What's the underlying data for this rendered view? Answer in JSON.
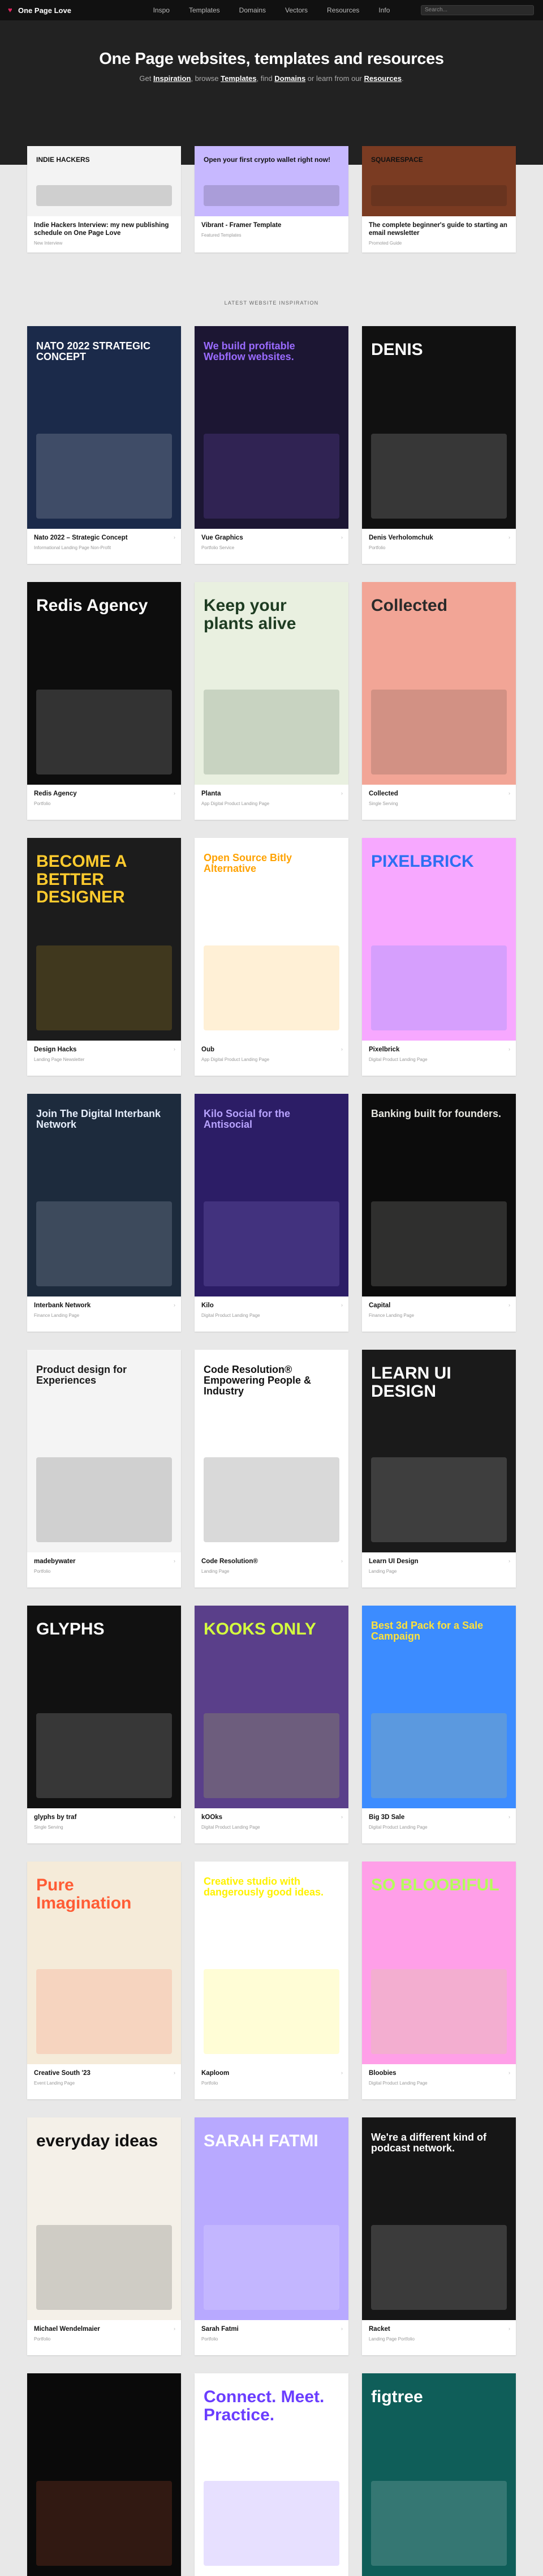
{
  "site": {
    "name": "One Page Love"
  },
  "nav": {
    "items": [
      "Inspo",
      "Templates",
      "Domains",
      "Vectors",
      "Resources",
      "Info"
    ]
  },
  "search": {
    "placeholder": "Search..."
  },
  "hero": {
    "title": "One Page websites, templates and resources",
    "sub_pre": "Get ",
    "inspiration": "Inspiration",
    "sub_mid1": ", browse ",
    "templates": "Templates",
    "sub_mid2": ", find ",
    "domains": "Domains",
    "sub_mid3": " or learn from our ",
    "resources": "Resources",
    "sub_end": "."
  },
  "featured": [
    {
      "title": "Indie Hackers Interview: my new publishing schedule on One Page Love",
      "tag": "New Interview",
      "thumb_text": "INDIE HACKERS",
      "bg": "#f3f3f3"
    },
    {
      "title": "Vibrant - Framer Template",
      "tag": "Featured Templates",
      "thumb_text": "Open your first crypto wallet right now!",
      "bg": "#c7b8ff"
    },
    {
      "title": "The complete beginner's guide to starting an email newsletter",
      "tag": "Promoted Guide",
      "thumb_text": "SQUARESPACE",
      "bg": "#7a3b22"
    }
  ],
  "section": {
    "label": "LATEST WEBSITE INSPIRATION"
  },
  "cards": [
    {
      "title": "Nato 2022 – Strategic Concept",
      "tags": [
        "Informational",
        "Landing Page",
        "Non-Profit"
      ],
      "bg": "#1b2a4a",
      "accent": "#ffffff",
      "thumb_text": "NATO 2022 STRATEGIC CONCEPT"
    },
    {
      "title": "Vue Graphics",
      "tags": [
        "Portfolio",
        "Service"
      ],
      "bg": "#1c1633",
      "accent": "#9a6bff",
      "thumb_text": "We build profitable Webflow websites."
    },
    {
      "title": "Denis Verholomchuk",
      "tags": [
        "Portfolio"
      ],
      "bg": "#111111",
      "accent": "#ffffff",
      "thumb_text": "DENIS"
    },
    {
      "title": "Redis Agency",
      "tags": [
        "Portfolio"
      ],
      "bg": "#0d0d0d",
      "accent": "#ffffff",
      "thumb_text": "Redis Agency"
    },
    {
      "title": "Planta",
      "tags": [
        "App",
        "Digital Product",
        "Landing Page"
      ],
      "bg": "#e9f0e0",
      "accent": "#1e3c22",
      "thumb_text": "Keep your plants alive"
    },
    {
      "title": "Collected",
      "tags": [
        "Single Serving"
      ],
      "bg": "#f2a596",
      "accent": "#2a2a2a",
      "thumb_text": "Collected"
    },
    {
      "title": "Design Hacks",
      "tags": [
        "Landing Page",
        "Newsletter"
      ],
      "bg": "#1c1c1c",
      "accent": "#ffcb2e",
      "thumb_text": "BECOME A BETTER DESIGNER"
    },
    {
      "title": "Oub",
      "tags": [
        "App",
        "Digital Product",
        "Landing Page"
      ],
      "bg": "#ffffff",
      "accent": "#ffa200",
      "thumb_text": "Open Source Bitly Alternative"
    },
    {
      "title": "Pixelbrick",
      "tags": [
        "Digital Product",
        "Landing Page"
      ],
      "bg": "#f7a8ff",
      "accent": "#2d6ff2",
      "thumb_text": "PIXELBRICK"
    },
    {
      "title": "Interbank Network",
      "tags": [
        "Finance",
        "Landing Page"
      ],
      "bg": "#1d2b3d",
      "accent": "#e6eefc",
      "thumb_text": "Join The Digital Interbank Network"
    },
    {
      "title": "Kilo",
      "tags": [
        "Digital Product",
        "Landing Page"
      ],
      "bg": "#2c1d66",
      "accent": "#b8a3ff",
      "thumb_text": "Kilo Social for the Antisocial"
    },
    {
      "title": "Capital",
      "tags": [
        "Finance",
        "Landing Page"
      ],
      "bg": "#0c0c0c",
      "accent": "#e8e8e2",
      "thumb_text": "Banking built for founders."
    },
    {
      "title": "madebywater",
      "tags": [
        "Portfolio"
      ],
      "bg": "#f4f4f4",
      "accent": "#1a1a1a",
      "thumb_text": "Product design for Experiences"
    },
    {
      "title": "Code Resolution®",
      "tags": [
        "Landing Page"
      ],
      "bg": "#ffffff",
      "accent": "#111111",
      "thumb_text": "Code Resolution® Empowering People & Industry"
    },
    {
      "title": "Learn UI Design",
      "tags": [
        "Landing Page"
      ],
      "bg": "#1a1a1a",
      "accent": "#ffffff",
      "thumb_text": "LEARN UI DESIGN"
    },
    {
      "title": "glyphs by traf",
      "tags": [
        "Single Serving"
      ],
      "bg": "#111111",
      "accent": "#ffffff",
      "thumb_text": "GLYPHS"
    },
    {
      "title": "kOOks",
      "tags": [
        "Digital Product",
        "Landing Page"
      ],
      "bg": "#5a3f8a",
      "accent": "#d5ff3f",
      "thumb_text": "KOOKS ONLY"
    },
    {
      "title": "Big 3D Sale",
      "tags": [
        "Digital Product",
        "Landing Page"
      ],
      "bg": "#3c8cff",
      "accent": "#ffe23a",
      "thumb_text": "Best 3d Pack for a Sale Campaign"
    },
    {
      "title": "Creative South '23",
      "tags": [
        "Event",
        "Landing Page"
      ],
      "bg": "#f5ebd9",
      "accent": "#ff5c35",
      "thumb_text": "Pure Imagination"
    },
    {
      "title": "Kaploom",
      "tags": [
        "Portfolio"
      ],
      "bg": "#ffffff",
      "accent": "#fff200",
      "thumb_text": "Creative studio with dangerously good ideas."
    },
    {
      "title": "Bloobies",
      "tags": [
        "Digital Product",
        "Landing Page"
      ],
      "bg": "#ff9fe8",
      "accent": "#b4ff5a",
      "thumb_text": "SO BLOOBIFUL"
    },
    {
      "title": "Michael Wendelmaier",
      "tags": [
        "Portfolio"
      ],
      "bg": "#f4f0e8",
      "accent": "#111111",
      "thumb_text": "everyday ideas"
    },
    {
      "title": "Sarah Fatmi",
      "tags": [
        "Portfolio"
      ],
      "bg": "#b8a9ff",
      "accent": "#ffffff",
      "thumb_text": "SARAH FATMI"
    },
    {
      "title": "Racket",
      "tags": [
        "Landing Page",
        "Portfolio"
      ],
      "bg": "#161616",
      "accent": "#ffffff",
      "thumb_text": "We're a different kind of podcast network."
    },
    {
      "title": "",
      "tags": [],
      "bg": "#0a0a0a",
      "accent": "#ff6a3d",
      "thumb_text": ""
    },
    {
      "title": "",
      "tags": [],
      "bg": "#ffffff",
      "accent": "#6a3dff",
      "thumb_text": "Connect. Meet. Practice."
    },
    {
      "title": "",
      "tags": [],
      "bg": "#0f5e59",
      "accent": "#ffffff",
      "thumb_text": "figtree"
    }
  ]
}
